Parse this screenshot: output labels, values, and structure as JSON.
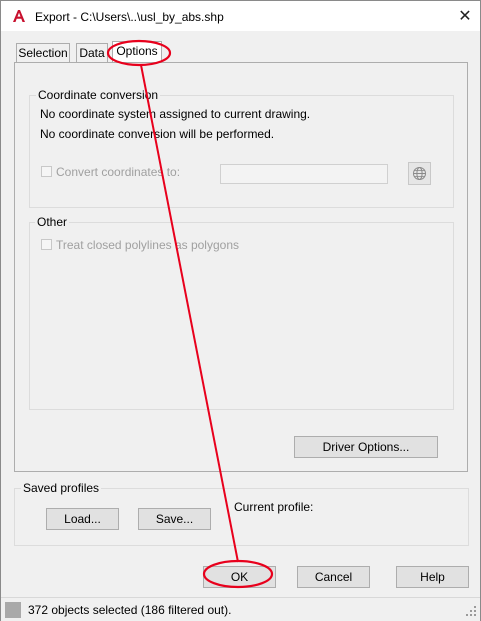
{
  "window": {
    "title": "Export - C:\\Users\\..\\usl_by_abs.shp",
    "app_icon": "autocad-a-icon",
    "close_icon": "close-icon",
    "close_glyph": "✕"
  },
  "tabs": [
    {
      "label": "Selection",
      "active": false
    },
    {
      "label": "Data",
      "active": false
    },
    {
      "label": "Options",
      "active": true
    }
  ],
  "coordinate_conversion": {
    "group_label": "Coordinate conversion",
    "line1": "No coordinate system assigned to current drawing.",
    "line2": "No coordinate conversion will be performed.",
    "convert_checkbox_label": "Convert coordinates to:",
    "convert_checked": false,
    "target_value": "",
    "globe_button_icon": "globe-icon"
  },
  "other": {
    "group_label": "Other",
    "closed_polylines_label": "Treat closed polylines as polygons",
    "closed_polylines_checked": false
  },
  "driver_options_label": "Driver Options...",
  "saved_profiles": {
    "group_label": "Saved profiles",
    "load_label": "Load...",
    "save_label": "Save...",
    "current_profile_label": "Current profile:"
  },
  "footer": {
    "ok_label": "OK",
    "cancel_label": "Cancel",
    "help_label": "Help"
  },
  "status": {
    "text": "372 objects selected (186 filtered out)."
  },
  "annotation_color": "#e8001c"
}
